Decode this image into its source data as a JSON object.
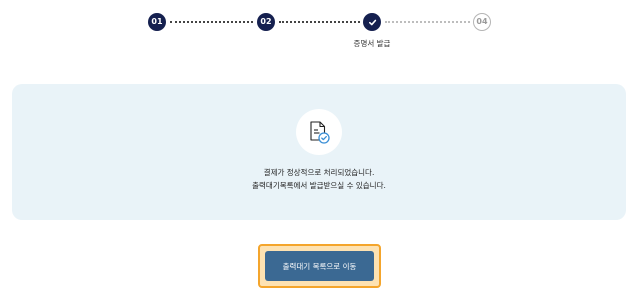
{
  "stepper": {
    "steps": [
      {
        "label": "01",
        "status": "done"
      },
      {
        "label": "02",
        "status": "done"
      },
      {
        "label": "",
        "status": "current",
        "icon": "check-icon",
        "caption": "증명서 발급"
      },
      {
        "label": "04",
        "status": "pending"
      }
    ],
    "current_step_caption": "증명서 발급"
  },
  "result": {
    "icon": "document-check-icon",
    "message_line1": "결제가 정상적으로 처리되었습니다.",
    "message_line2": "출력대기목록에서 발급받으실 수 있습니다."
  },
  "actions": {
    "go_print_queue_label": "출력대기 목록으로 이동"
  },
  "colors": {
    "step_done": "#15204f",
    "panel_bg": "#e9f3f8",
    "button_bg": "#3b6993",
    "button_highlight": "#f4a52c",
    "icon_accent": "#3a8fd6"
  }
}
